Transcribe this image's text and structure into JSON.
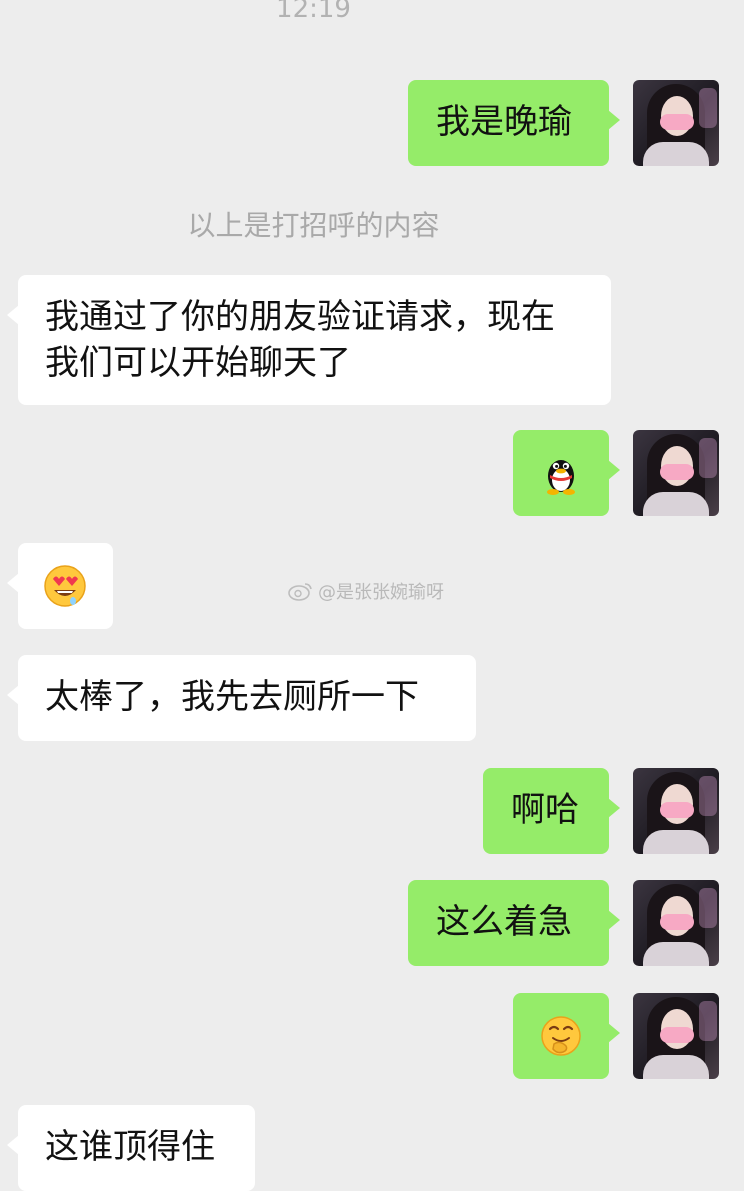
{
  "chat": {
    "timestamp": "12:19",
    "system_note": "以上是打招呼的内容",
    "watermark": "@是张张婉瑜呀",
    "messages": [
      {
        "side": "right",
        "type": "text",
        "text": "我是晚瑜"
      },
      {
        "side": "left",
        "type": "text",
        "lines": [
          "我通过了你的朋友验证请求，现在",
          "我们可以开始聊天了"
        ]
      },
      {
        "side": "right",
        "type": "sticker",
        "icon": "qq-penguin-icon"
      },
      {
        "side": "left",
        "type": "sticker",
        "icon": "heart-eyes-emoji-icon"
      },
      {
        "side": "left",
        "type": "text",
        "text": "太棒了，我先去厕所一下"
      },
      {
        "side": "right",
        "type": "text",
        "text": "啊哈"
      },
      {
        "side": "right",
        "type": "text",
        "text": "这么着急"
      },
      {
        "side": "right",
        "type": "sticker",
        "icon": "laughing-hand-emoji-icon"
      },
      {
        "side": "left",
        "type": "text",
        "text": "这谁顶得住"
      }
    ]
  },
  "colors": {
    "background": "#ededed",
    "sent_bubble": "#95ec69",
    "received_bubble": "#ffffff",
    "meta_text": "#b2b2b2"
  }
}
